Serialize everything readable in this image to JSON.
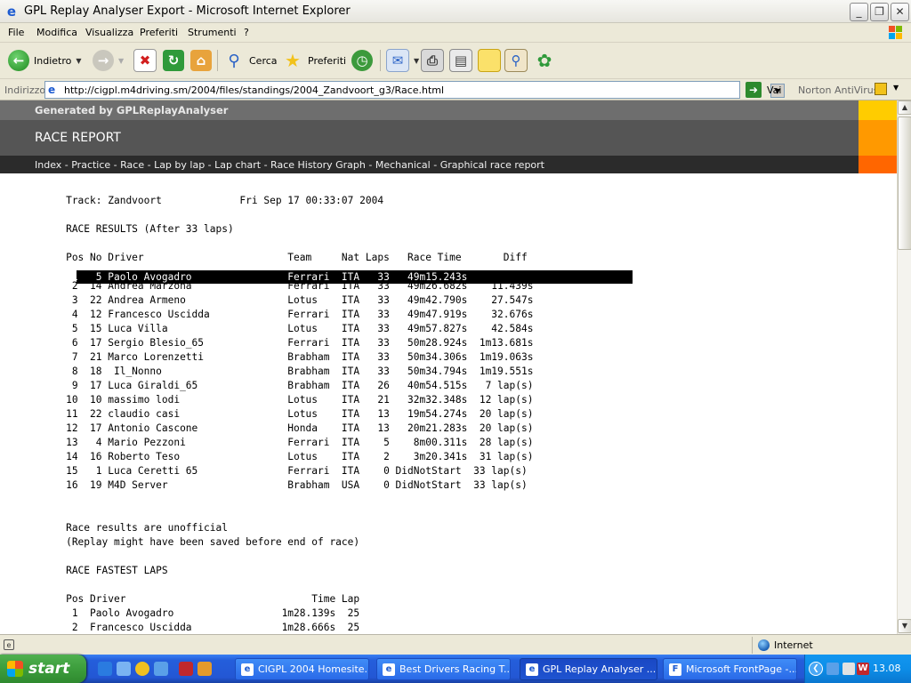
{
  "window": {
    "title": "GPL Replay Analyser Export - Microsoft Internet Explorer",
    "min": "_",
    "max": "❐",
    "close": "✕"
  },
  "menu": [
    "File",
    "Modifica",
    "Visualizza",
    "Preferiti",
    "Strumenti",
    "?"
  ],
  "toolbar": {
    "back": "Indietro",
    "search": "Cerca",
    "favorites": "Preferiti"
  },
  "address": {
    "label": "Indirizzo",
    "url": "http://cigpl.m4driving.sm/2004/files/standings/2004_Zandvoort_g3/Race.html",
    "go": "Vai",
    "norton": "Norton AntiVirus"
  },
  "page": {
    "generated_by": "Generated by GPLReplayAnalyser",
    "heading": "RACE REPORT",
    "nav": "Index - Practice - Race - Lap by lap - Lap chart - Race History Graph - Mechanical - Graphical race report",
    "highlight_row": "            1   5 Paolo Avogadro                Ferrari  ITA   33   49m15.243s",
    "report_text": "           Track: Zandvoort             Fri Sep 17 00:33:07 2004\n\n           RACE RESULTS (After 33 laps)\n\n           Pos No Driver                        Team     Nat Laps   Race Time       Diff\n\n            2  14 Andrea Marzona                Ferrari  ITA   33   49m26.682s    11.439s\n            3  22 Andrea Armeno                 Lotus    ITA   33   49m42.790s    27.547s\n            4  12 Francesco Uscidda             Ferrari  ITA   33   49m47.919s    32.676s\n            5  15 Luca Villa                    Lotus    ITA   33   49m57.827s    42.584s\n            6  17 Sergio Blesio_65              Ferrari  ITA   33   50m28.924s  1m13.681s\n            7  21 Marco Lorenzetti              Brabham  ITA   33   50m34.306s  1m19.063s\n            8  18  Il_Nonno                     Brabham  ITA   33   50m34.794s  1m19.551s\n            9  17 Luca Giraldi_65               Brabham  ITA   26   40m54.515s   7 lap(s)\n           10  10 massimo lodi                  Lotus    ITA   21   32m32.348s  12 lap(s)\n           11  22 claudio casi                  Lotus    ITA   13   19m54.274s  20 lap(s)\n           12  17 Antonio Cascone               Honda    ITA   13   20m21.283s  20 lap(s)\n           13   4 Mario Pezzoni                 Ferrari  ITA    5    8m00.311s  28 lap(s)\n           14  16 Roberto Teso                  Lotus    ITA    2    3m20.341s  31 lap(s)\n           15   1 Luca Ceretti 65               Ferrari  ITA    0 DidNotStart  33 lap(s)\n           16  19 M4D Server                    Brabham  USA    0 DidNotStart  33 lap(s)\n\n\n           Race results are unofficial\n           (Replay might have been saved before end of race)\n\n           RACE FASTEST LAPS\n\n           Pos Driver                               Time Lap\n            1  Paolo Avogadro                  1m28.139s  25\n            2  Francesco Uscidda               1m28.666s  25"
  },
  "status": {
    "zone": "Internet"
  },
  "taskbar": {
    "start": "start",
    "tasks": [
      "CIGPL 2004 Homesite...",
      "Best Drivers Racing T...",
      "GPL Replay Analyser ...",
      "Microsoft FrontPage -..."
    ],
    "clock": "13.08"
  },
  "colors": {
    "header_accent_1": "#ffcc00",
    "header_accent_2": "#ff9900",
    "header_accent_3": "#ff6600"
  }
}
